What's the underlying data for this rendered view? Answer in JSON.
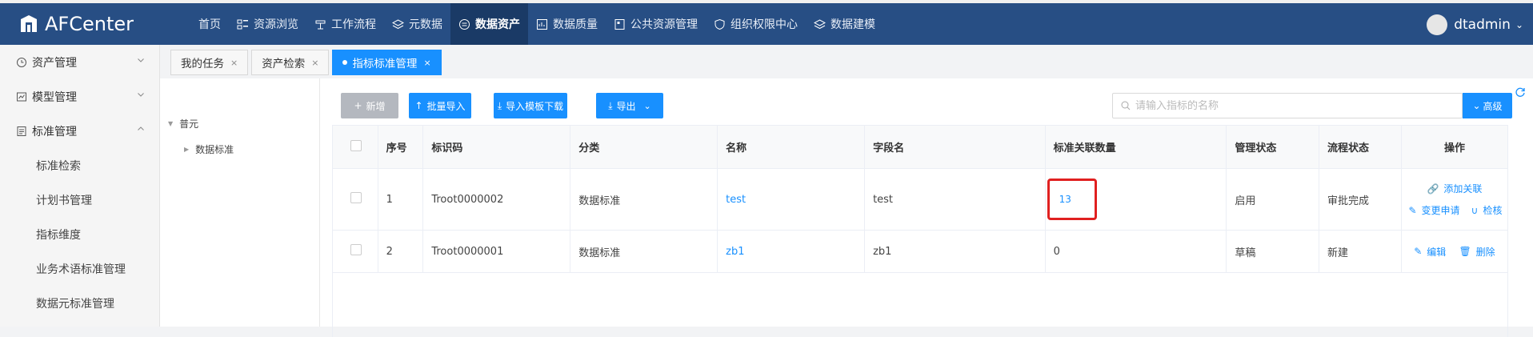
{
  "app": {
    "title": "AFCenter",
    "user": "dtadmin"
  },
  "nav": [
    {
      "label": "首页",
      "icon": "none"
    },
    {
      "label": "资源浏览",
      "icon": "grid-icon"
    },
    {
      "label": "工作流程",
      "icon": "workflow-icon"
    },
    {
      "label": "元数据",
      "icon": "layers-icon"
    },
    {
      "label": "数据资产",
      "icon": "asset-icon"
    },
    {
      "label": "数据质量",
      "icon": "chart-icon"
    },
    {
      "label": "公共资源管理",
      "icon": "resource-icon"
    },
    {
      "label": "组织权限中心",
      "icon": "shield-icon"
    },
    {
      "label": "数据建模",
      "icon": "layers-icon"
    }
  ],
  "sidebar": {
    "groups": [
      {
        "label": "资产管理",
        "icon": "clock-icon"
      },
      {
        "label": "模型管理",
        "icon": "model-icon"
      },
      {
        "label": "标准管理",
        "icon": "doc-icon"
      }
    ],
    "sub_items": [
      "标准检索",
      "计划书管理",
      "指标维度",
      "业务术语标准管理",
      "数据元标准管理"
    ]
  },
  "tabs": [
    {
      "label": "我的任务"
    },
    {
      "label": "资产检索"
    },
    {
      "label": "指标标准管理",
      "active": true
    }
  ],
  "tree": {
    "root": "普元",
    "child": "数据标准"
  },
  "toolbar": {
    "add_label": "新增",
    "batch_import_label": "批量导入",
    "template_download_label": "导入模板下载",
    "export_label": "导出",
    "search_placeholder": "请输入指标的名称",
    "advanced_label": "高级"
  },
  "table": {
    "columns": [
      "序号",
      "标识码",
      "分类",
      "名称",
      "字段名",
      "标准关联数量",
      "管理状态",
      "流程状态",
      "操作"
    ],
    "rows": [
      {
        "index": "1",
        "code": "Troot0000002",
        "category": "数据标准",
        "name": "test",
        "field": "test",
        "count": "13",
        "manage_status": "启用",
        "flow_status": "审批完成",
        "ops": [
          "添加关联",
          "变更申请",
          "检核"
        ]
      },
      {
        "index": "2",
        "code": "Troot0000001",
        "category": "数据标准",
        "name": "zb1",
        "field": "zb1",
        "count": "0",
        "manage_status": "草稿",
        "flow_status": "新建",
        "ops": [
          "编辑",
          "删除"
        ]
      }
    ]
  },
  "colors": {
    "topbar": "#274e84",
    "accent": "#1890ff",
    "highlight": "#e02020"
  }
}
